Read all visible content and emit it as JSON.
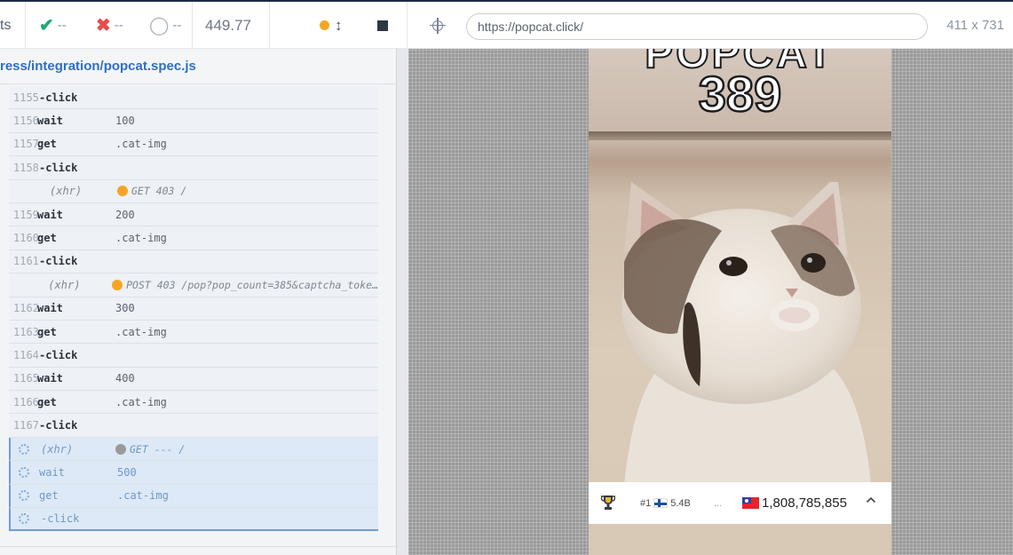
{
  "toolbar": {
    "tests_label_fragment": "ts",
    "passed_icon": "check-icon",
    "passed_count": "--",
    "failed_icon": "cross-icon",
    "failed_count": "--",
    "pending_icon": "circle-icon",
    "pending_count": "--",
    "duration": "449.77",
    "status_color": "#f5a524",
    "url": "https://popcat.click/",
    "viewport_size": "411 x 731"
  },
  "spec": {
    "path": "ress/integration/popcat.spec.js"
  },
  "commands": [
    {
      "num": "1155",
      "name": "-click",
      "msg": "",
      "type": "sub"
    },
    {
      "num": "1156",
      "name": "wait",
      "msg": "100",
      "type": "cmd"
    },
    {
      "num": "1157",
      "name": "get",
      "msg": ".cat-img",
      "type": "cmd"
    },
    {
      "num": "1158",
      "name": "-click",
      "msg": "",
      "type": "sub"
    },
    {
      "num": "",
      "name": "(xhr)",
      "msg": "GET 403 /",
      "type": "xhr",
      "status_color": "#f5a524"
    },
    {
      "num": "1159",
      "name": "wait",
      "msg": "200",
      "type": "cmd"
    },
    {
      "num": "1160",
      "name": "get",
      "msg": ".cat-img",
      "type": "cmd"
    },
    {
      "num": "1161",
      "name": "-click",
      "msg": "",
      "type": "sub"
    },
    {
      "num": "",
      "name": "(xhr)",
      "msg": "POST 403 /pop?pop_count=385&captcha_toke…",
      "type": "xhr",
      "status_color": "#f5a524"
    },
    {
      "num": "1162",
      "name": "wait",
      "msg": "300",
      "type": "cmd"
    },
    {
      "num": "1163",
      "name": "get",
      "msg": ".cat-img",
      "type": "cmd"
    },
    {
      "num": "1164",
      "name": "-click",
      "msg": "",
      "type": "sub"
    },
    {
      "num": "1165",
      "name": "wait",
      "msg": "400",
      "type": "cmd"
    },
    {
      "num": "1166",
      "name": "get",
      "msg": ".cat-img",
      "type": "cmd"
    },
    {
      "num": "1167",
      "name": "-click",
      "msg": "",
      "type": "sub"
    },
    {
      "num": "",
      "name": "(xhr)",
      "msg": "GET --- /",
      "type": "pending-xhr",
      "status_color": "#9a9a9a"
    },
    {
      "num": "",
      "name": "wait",
      "msg": "500",
      "type": "pending"
    },
    {
      "num": "",
      "name": "get",
      "msg": ".cat-img",
      "type": "pending"
    },
    {
      "num": "",
      "name": "-click",
      "msg": "",
      "type": "pending-sub"
    }
  ],
  "app": {
    "title_fragment": "POPCAT",
    "pop_count": "389",
    "leaderboard": {
      "trophy_icon": "trophy-icon",
      "rank": "#1",
      "rank_country_flag": "finland-flag-icon",
      "rank_value": "5.4B",
      "ellipsis": "...",
      "local_flag": "taiwan-flag-icon",
      "local_total": "1,808,785,855",
      "expand_icon": "chevron-up-icon"
    }
  }
}
